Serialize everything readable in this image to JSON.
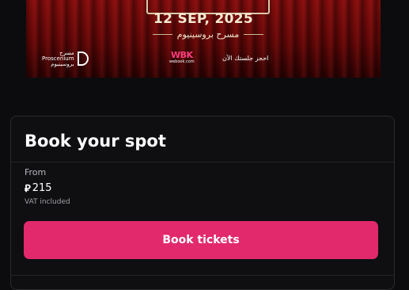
{
  "banner": {
    "date": "12 SEP, 2025",
    "venue_ar": "مسرح بروسينيوم",
    "prosc_ar_top": "مسرح",
    "prosc_en": "Proscenium",
    "prosc_ar_bottom": "بروسينيوم",
    "webook_logo": "WBK",
    "webook_site": "webook.com",
    "webook_cta_ar": "احجز جلستك الآن"
  },
  "booking": {
    "title": "Book your spot",
    "from_label": "From",
    "currency_symbol": "⃁",
    "price": "215",
    "vat_note": "VAT included",
    "button_label": "Book tickets"
  },
  "colors": {
    "accent": "#e2296c",
    "background": "#0c0c0e",
    "card_border": "#2a2a2e"
  }
}
